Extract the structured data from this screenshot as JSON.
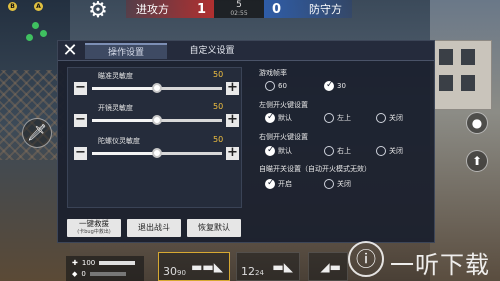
{
  "hud": {
    "minimap_markers": [
      "B",
      "A"
    ],
    "score": {
      "attack_label": "进攻方",
      "attack_score": "1",
      "round": "5",
      "timer": "02:55",
      "defend_score": "0",
      "defend_label": "防守方"
    },
    "status": {
      "health": "100",
      "armor": "0"
    },
    "weapons": [
      {
        "ammo": "30",
        "reserve": "90",
        "icon": "rifle-icon"
      },
      {
        "ammo": "12",
        "reserve": "24",
        "icon": "pistol-icon"
      },
      {
        "ammo": "",
        "reserve": "",
        "icon": "knife-icon"
      }
    ]
  },
  "panel": {
    "tabs": [
      "操作设置",
      "自定义设置"
    ],
    "sliders": [
      {
        "label": "瞄准灵敏度",
        "value": "50",
        "fraction": 0.5
      },
      {
        "label": "开镜灵敏度",
        "value": "50",
        "fraction": 0.5
      },
      {
        "label": "陀螺仪灵敏度",
        "value": "50",
        "fraction": 0.5
      }
    ],
    "actions": [
      {
        "label": "一键救援",
        "sub": "(卡bug中救出)"
      },
      {
        "label": "退出战斗"
      },
      {
        "label": "恢复默认"
      }
    ],
    "fps": {
      "title": "游戏帧率",
      "options": [
        "60",
        "30"
      ],
      "selected": 1
    },
    "left_fire": {
      "title": "左侧开火键设置",
      "options": [
        "默认",
        "左上",
        "关闭"
      ],
      "selected": 0
    },
    "right_fire": {
      "title": "右侧开火键设置",
      "options": [
        "默认",
        "右上",
        "关闭"
      ],
      "selected": 0
    },
    "auto_fire": {
      "title": "自瞄开关设置（自动开火模式无效）",
      "options": [
        "开启",
        "关闭"
      ],
      "selected": 0
    }
  },
  "watermark": "一听下载",
  "colors": {
    "attack": "#b03030",
    "defend": "#2f5da8",
    "slider_value": "#f0c040"
  }
}
